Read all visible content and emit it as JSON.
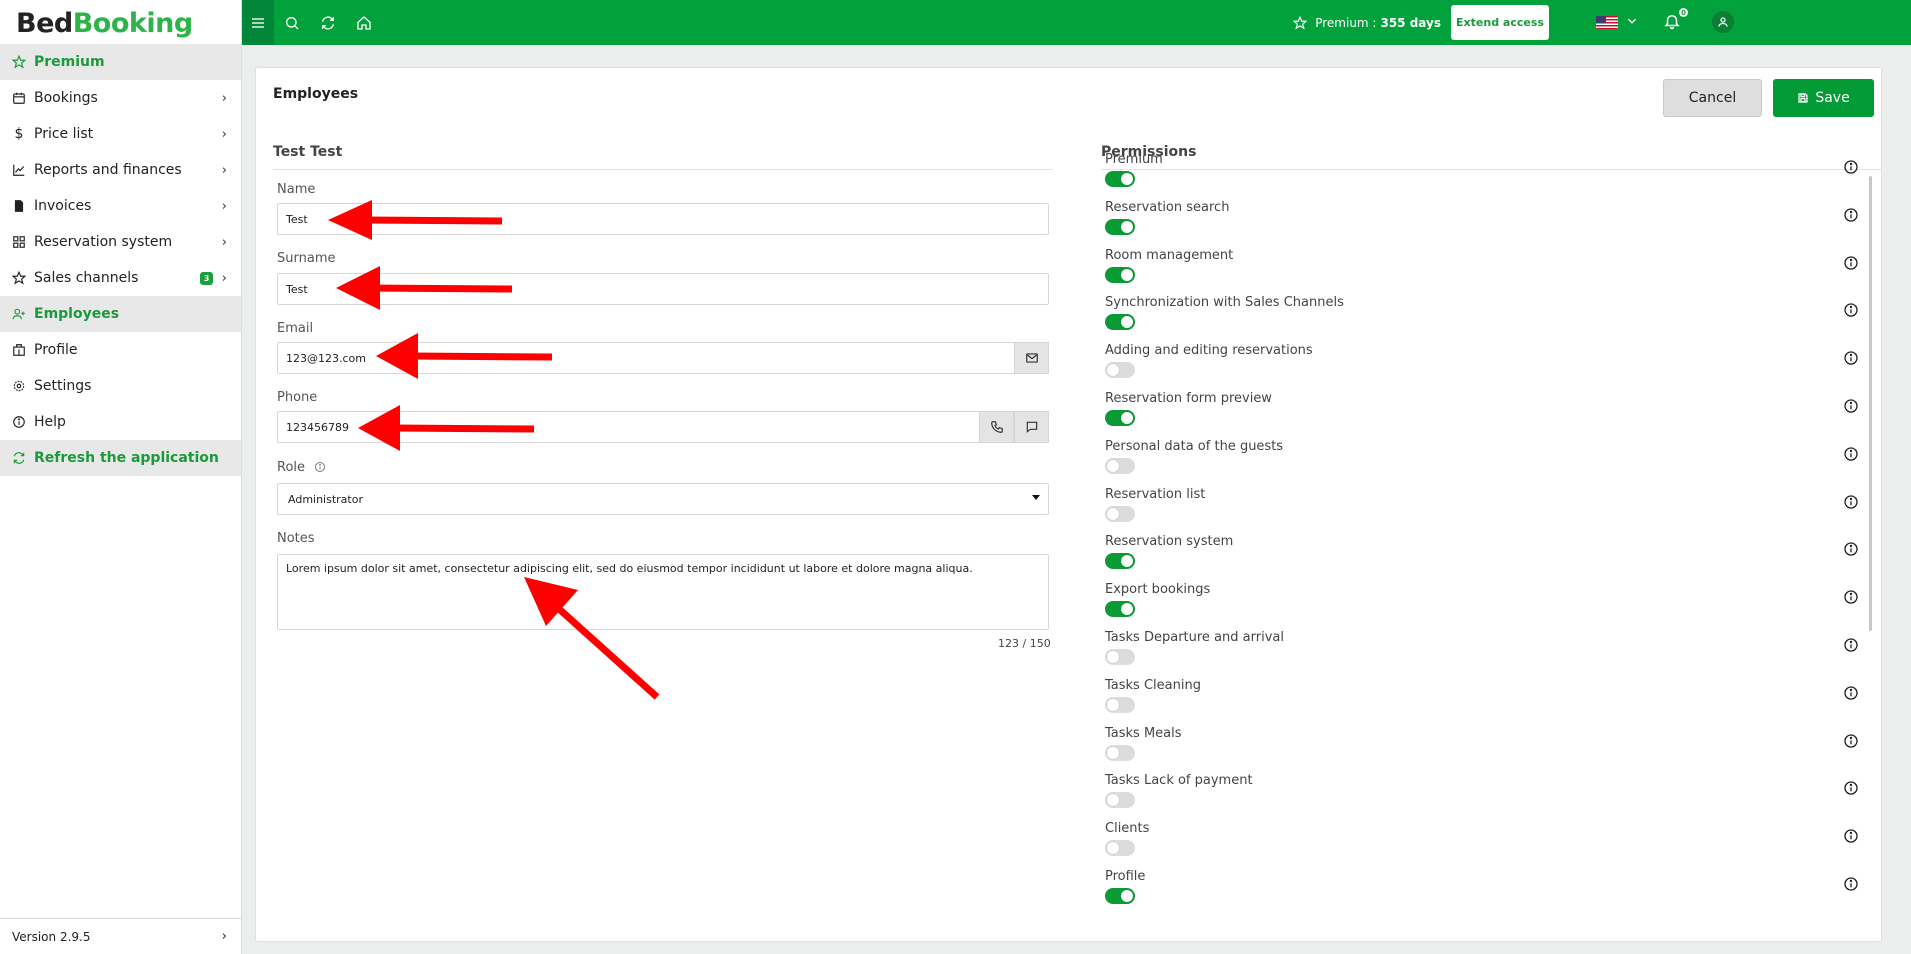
{
  "app": {
    "logo_part1": "Bed",
    "logo_part2": "Booking",
    "version": "Version 2.9.5"
  },
  "sidebar": {
    "items": [
      {
        "label": "Premium",
        "icon": "star-icon"
      },
      {
        "label": "Bookings",
        "icon": "calendar-icon"
      },
      {
        "label": "Price list",
        "icon": "dollar-icon"
      },
      {
        "label": "Reports and finances",
        "icon": "chart-icon"
      },
      {
        "label": "Invoices",
        "icon": "invoice-icon"
      },
      {
        "label": "Reservation system",
        "icon": "grid-icon"
      },
      {
        "label": "Sales channels",
        "icon": "star-outline-icon",
        "badge": "3"
      },
      {
        "label": "Employees",
        "icon": "user-plus-icon"
      },
      {
        "label": "Profile",
        "icon": "building-icon"
      },
      {
        "label": "Settings",
        "icon": "gear-icon"
      },
      {
        "label": "Help",
        "icon": "info-icon"
      },
      {
        "label": "Refresh the application",
        "icon": "refresh-icon"
      }
    ]
  },
  "topbar": {
    "premium_label": "Premium :",
    "premium_days": "355 days",
    "extend_label": "Extend access",
    "notification_count": "0"
  },
  "page": {
    "title": "Employees",
    "cancel_label": "Cancel",
    "save_label": "Save"
  },
  "form": {
    "section_title": "Test Test",
    "name_label": "Name",
    "name_value": "Test",
    "surname_label": "Surname",
    "surname_value": "Test",
    "email_label": "Email",
    "email_value": "123@123.com",
    "phone_label": "Phone",
    "phone_value": "123456789",
    "role_label": "Role",
    "role_value": "Administrator",
    "notes_label": "Notes",
    "notes_value": "Lorem ipsum dolor sit amet, consectetur adipiscing elit, sed do eiusmod tempor incididunt ut labore et dolore magna aliqua.",
    "notes_counter": "123 / 150"
  },
  "permissions": {
    "title": "Permissions",
    "items": [
      {
        "label": "Premium",
        "on": true
      },
      {
        "label": "Reservation search",
        "on": true
      },
      {
        "label": "Room management",
        "on": true
      },
      {
        "label": "Synchronization with Sales Channels",
        "on": true
      },
      {
        "label": "Adding and editing reservations",
        "on": false
      },
      {
        "label": "Reservation form preview",
        "on": true
      },
      {
        "label": "Personal data of the guests",
        "on": false
      },
      {
        "label": "Reservation list",
        "on": false
      },
      {
        "label": "Reservation system",
        "on": true
      },
      {
        "label": "Export bookings",
        "on": true
      },
      {
        "label": "Tasks Departure and arrival",
        "on": false
      },
      {
        "label": "Tasks Cleaning",
        "on": false
      },
      {
        "label": "Tasks Meals",
        "on": false
      },
      {
        "label": "Tasks Lack of payment",
        "on": false
      },
      {
        "label": "Clients",
        "on": false
      },
      {
        "label": "Profile",
        "on": true
      }
    ]
  },
  "colors": {
    "brand_green": "#01a13b",
    "annotation_red": "#ff0000"
  }
}
